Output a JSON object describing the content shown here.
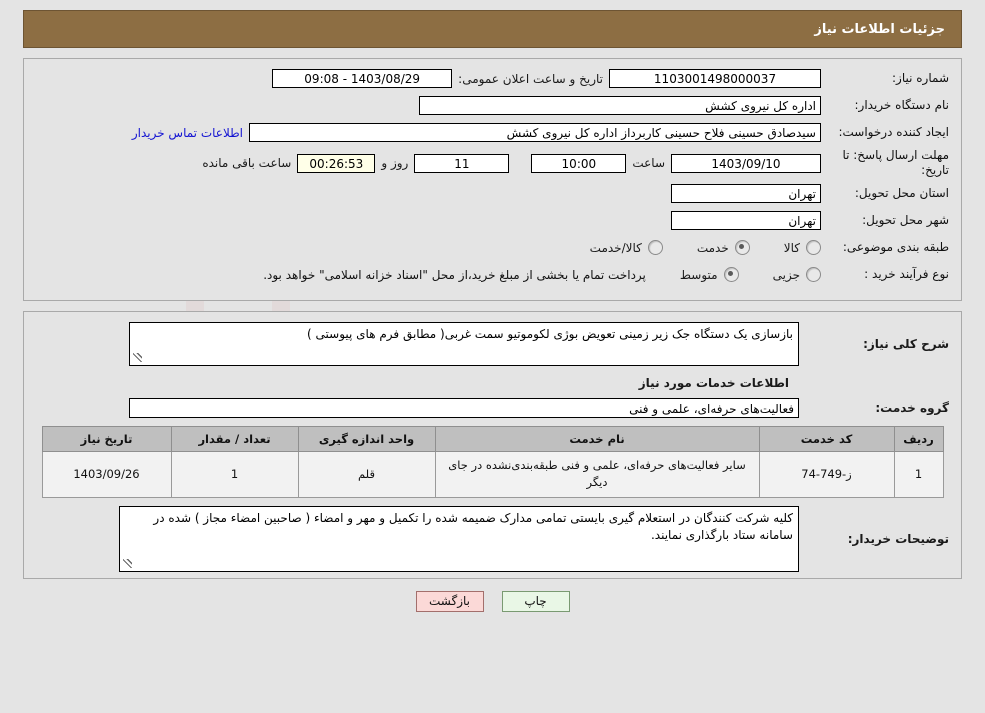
{
  "header": {
    "title": "جزئیات اطلاعات نیاز",
    "bg_color": "#8d6e43"
  },
  "watermark": {
    "text": "AriaTender.net"
  },
  "form": {
    "need_number": {
      "label": "شماره نیاز:",
      "value": "1103001498000037"
    },
    "public_announce": {
      "label": "تاریخ و ساعت اعلان عمومی:",
      "value": "1403/08/29 - 09:08"
    },
    "buyer_org": {
      "label": "نام دستگاه خریدار:",
      "value": "اداره کل نیروی کشش"
    },
    "request_creator": {
      "label": "ایجاد کننده درخواست:",
      "value": "سیدصادق حسینی فلاح حسینی کاربرداز اداره کل نیروی کشش"
    },
    "contact_link": "اطلاعات تماس خریدار",
    "deadline": {
      "label": "مهلت ارسال پاسخ: تا تاریخ:",
      "date": "1403/09/10",
      "time_label": "ساعت",
      "time": "10:00",
      "days": "11",
      "days_label": "روز و",
      "clock": "00:26:53",
      "remaining_label": "ساعت باقی مانده"
    },
    "delivery_province": {
      "label": "استان محل تحویل:",
      "value": "تهران"
    },
    "delivery_city": {
      "label": "شهر محل تحویل:",
      "value": "تهران"
    },
    "subject_category": {
      "label": "طبقه بندی موضوعی:",
      "options": [
        {
          "label": "کالا",
          "selected": false
        },
        {
          "label": "خدمت",
          "selected": true
        },
        {
          "label": "کالا/خدمت",
          "selected": false
        }
      ]
    },
    "purchase_process": {
      "label": "نوع فرآیند خرید :",
      "options": [
        {
          "label": "جزیی",
          "selected": false
        },
        {
          "label": "متوسط",
          "selected": true
        }
      ],
      "note": "پرداخت تمام یا بخشی از مبلغ خرید،از محل \"اسناد خزانه اسلامی\" خواهد بود."
    }
  },
  "description": {
    "label": "شرح کلی نیاز:",
    "value": "بازسازی یک دستگاه جک زیر زمینی تعویض بوژی لکوموتیو سمت غربی( مطابق فرم های پیوستی )"
  },
  "services_section": {
    "heading": "اطلاعات خدمات مورد نیاز",
    "service_group": {
      "label": "گروه خدمت:",
      "value": "فعالیت‌های حرفه‌ای، علمی و فنی"
    }
  },
  "table": {
    "columns": [
      "ردیف",
      "کد خدمت",
      "نام خدمت",
      "واحد اندازه گیری",
      "تعداد / مقدار",
      "تاریخ نیاز"
    ],
    "rows": [
      {
        "row": "1",
        "code": "ز-749-74",
        "name": "سایر فعالیت‌های حرفه‌ای، علمی و فنی طبقه‌بندی‌نشده در جای دیگر",
        "unit": "قلم",
        "quantity": "1",
        "need_date": "1403/09/26"
      }
    ]
  },
  "buyer_notes": {
    "label": "توضیحات خریدار:",
    "value": "کلیه شرکت کنندگان در استعلام گیری بایستی تمامی مدارک ضمیمه شده را تکمیل و مهر و امضاء ( صاحبین امضاء مجاز ) شده در سامانه ستاد بارگذاری نمایند."
  },
  "buttons": {
    "print": "چاپ",
    "back": "بازگشت"
  }
}
